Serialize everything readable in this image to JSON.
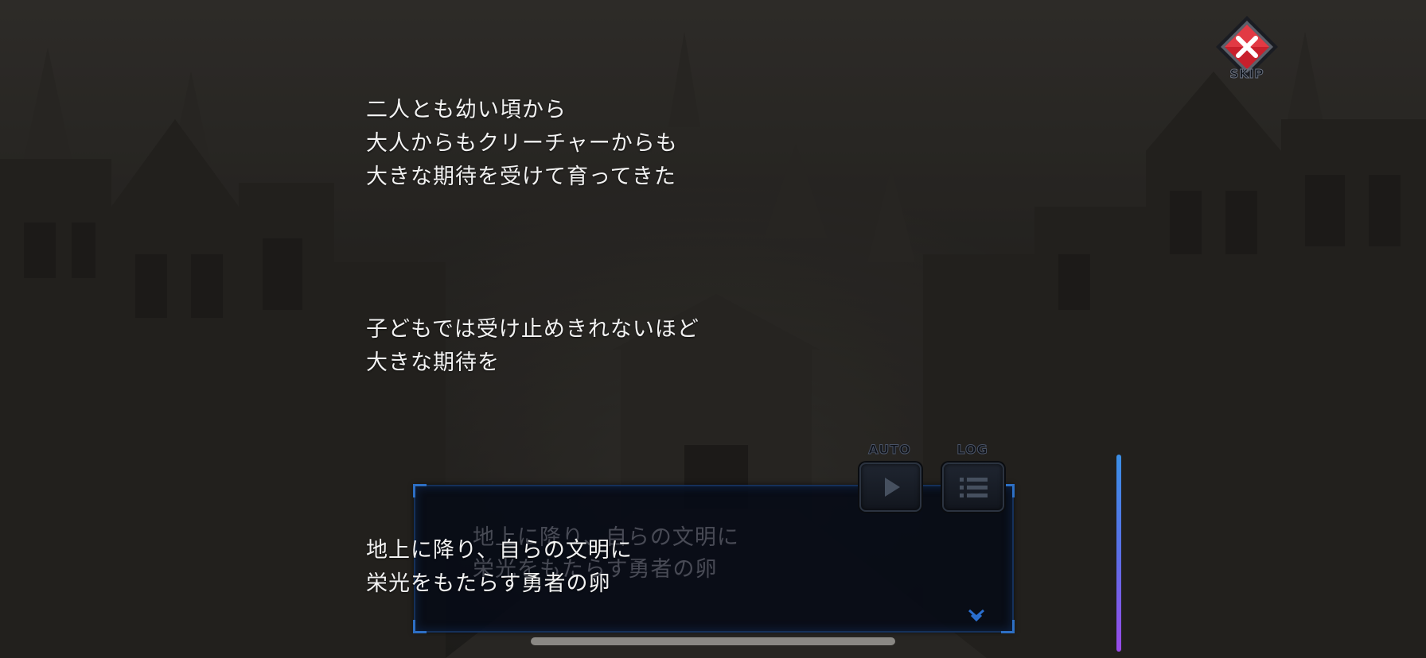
{
  "story": {
    "lines": [
      "二人とも幼い頃から",
      "大人からもクリーチャーからも",
      "大きな期待を受けて育ってきた",
      "子どもでは受け止めきれないほど",
      "大きな期待を",
      "地上に降り、自らの文明に",
      "栄光をもたらす勇者の卵"
    ]
  },
  "dialog": {
    "ghost_lines": [
      "地上に降り、自らの文明に",
      "栄光をもたらす勇者の卵"
    ]
  },
  "controls": {
    "skip_label": "SKIP",
    "auto_label": "AUTO",
    "log_label": "LOG"
  },
  "colors": {
    "skip_red": "#d8232e",
    "dialog_border": "#15305a",
    "accent_blue": "#3b8fe6",
    "accent_purple": "#9a4ae8"
  },
  "icons": {
    "skip": "close-x-icon",
    "auto": "play-icon",
    "log": "list-icon",
    "next": "chevron-down-icon"
  }
}
